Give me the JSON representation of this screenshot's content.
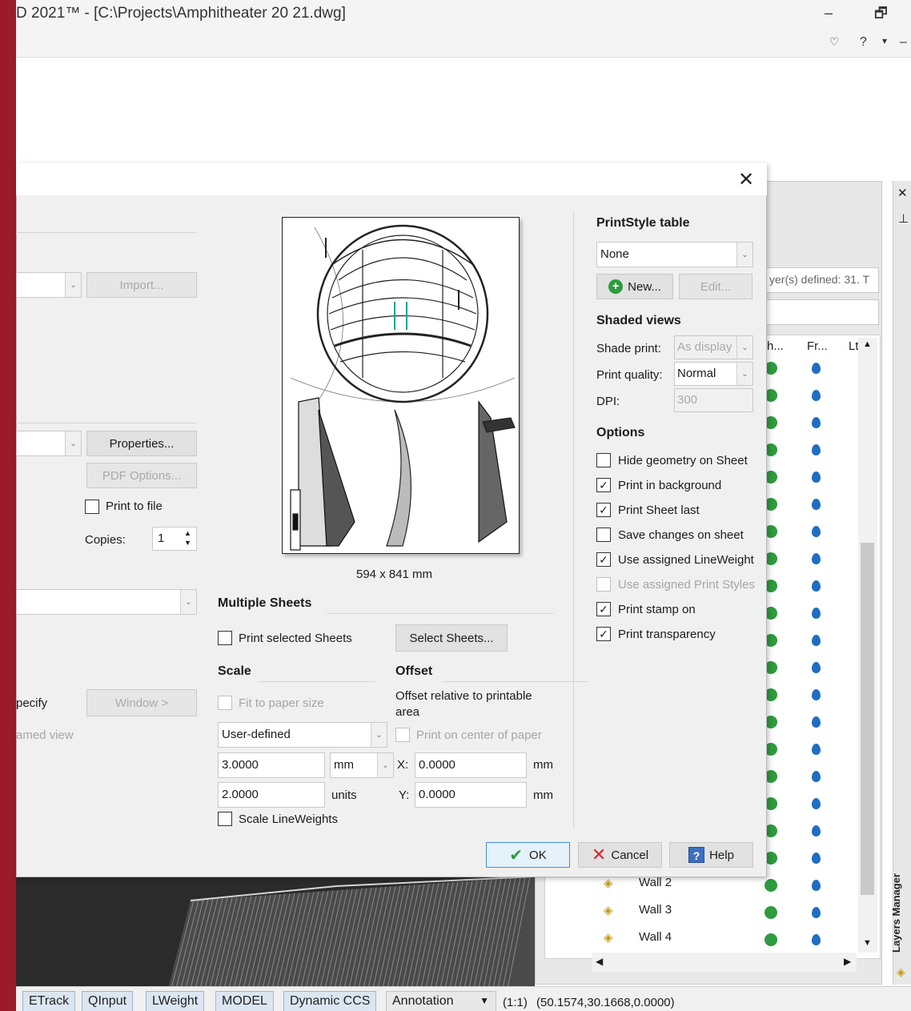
{
  "window": {
    "title": "D 2021™ - [C:\\Projects\\Amphitheater 20 21.dwg]",
    "minimize": "–",
    "restore": "🗗"
  },
  "layers_panel": {
    "count_text": "yer(s) defined: 31. T",
    "columns": [
      "h...",
      "Fr...",
      "Lt"
    ],
    "visible_rows": [
      "Wall 2",
      "Wall 3",
      "Wall 4"
    ],
    "panel_label": "Layers Manager",
    "close_glyph": "✕"
  },
  "dialog": {
    "close_glyph": "✕",
    "left": {
      "import_label": "Import...",
      "properties_label": "Properties...",
      "pdf_options_label": "PDF Options...",
      "print_to_file_label": "Print to file",
      "copies_label": "Copies:",
      "copies_value": "1",
      "specify_label": "pecify",
      "window_label": "Window >",
      "named_view_label": "amed view"
    },
    "preview": {
      "size_label": "594 x 841 mm"
    },
    "multiple_sheets": {
      "heading": "Multiple Sheets",
      "print_selected_label": "Print selected Sheets",
      "select_button": "Select Sheets..."
    },
    "scale": {
      "heading": "Scale",
      "fit_label": "Fit to paper size",
      "mode_value": "User-defined",
      "value1": "3.0000",
      "unit1": "mm",
      "value2": "2.0000",
      "unit2": "units",
      "scale_lineweights_label": "Scale LineWeights"
    },
    "offset": {
      "heading": "Offset",
      "relative_label": "Offset relative to printable area",
      "center_label": "Print on center of paper",
      "x_label": "X:",
      "x_value": "0.0000",
      "x_unit": "mm",
      "y_label": "Y:",
      "y_value": "0.0000",
      "y_unit": "mm"
    },
    "printstyle": {
      "heading": "PrintStyle table",
      "value": "None",
      "new_label": "New...",
      "edit_label": "Edit..."
    },
    "shaded": {
      "heading": "Shaded views",
      "shade_label": "Shade print:",
      "shade_value": "As display",
      "quality_label": "Print quality:",
      "quality_value": "Normal",
      "dpi_label": "DPI:",
      "dpi_value": "300"
    },
    "options": {
      "heading": "Options",
      "items": [
        {
          "label": "Hide geometry on Sheet",
          "checked": false,
          "enabled": true
        },
        {
          "label": "Print in background",
          "checked": true,
          "enabled": true
        },
        {
          "label": "Print Sheet last",
          "checked": true,
          "enabled": true
        },
        {
          "label": "Save changes on sheet",
          "checked": false,
          "enabled": true
        },
        {
          "label": "Use assigned LineWeight",
          "checked": true,
          "enabled": true
        },
        {
          "label": "Use assigned Print Styles",
          "checked": false,
          "enabled": false
        },
        {
          "label": "Print stamp on",
          "checked": true,
          "enabled": true
        },
        {
          "label": "Print transparency",
          "checked": true,
          "enabled": true
        }
      ]
    },
    "buttons": {
      "ok": "OK",
      "cancel": "Cancel",
      "help": "Help"
    }
  },
  "statusbar": {
    "buttons": [
      "ETrack",
      "QInput",
      "LWeight",
      "MODEL",
      "Dynamic CCS"
    ],
    "annotation": "Annotation",
    "scale": "(1:1)",
    "coords": "(50.1574,30.1668,0.0000)"
  },
  "colors": {
    "accent_bar": "#9b1b2a",
    "ok_check": "#2e9b3e",
    "cancel_x": "#d42a2a",
    "layer_dot": "#2e9b3e",
    "layer_drop": "#1f6ec2"
  }
}
